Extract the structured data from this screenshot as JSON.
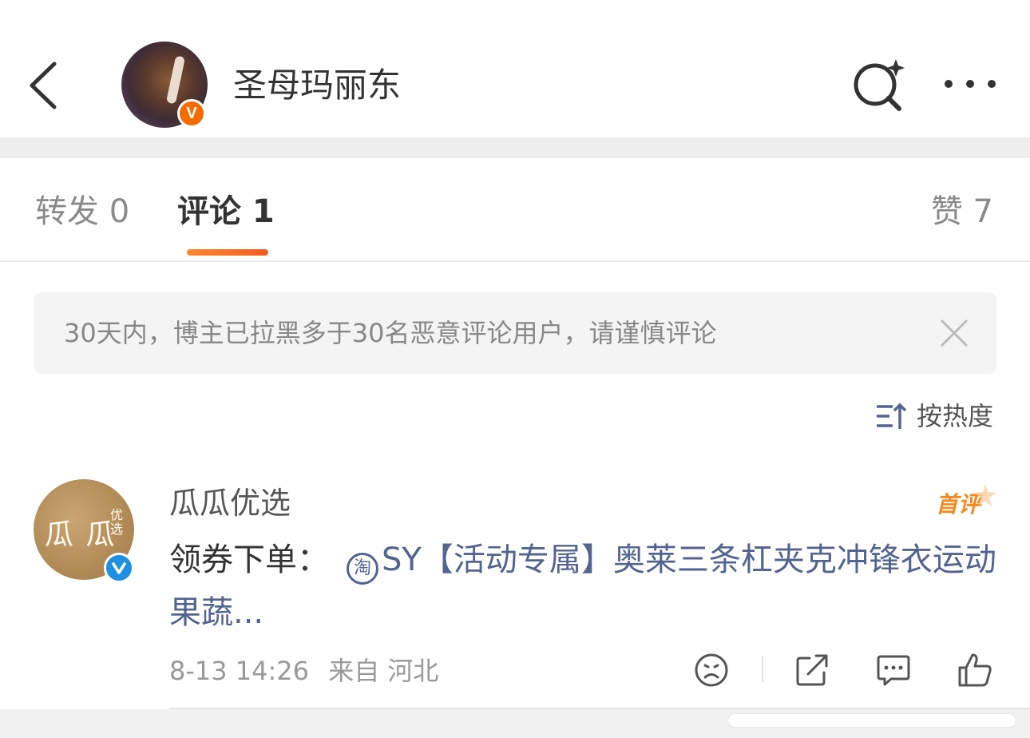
{
  "header": {
    "title": "圣母玛丽东",
    "badge_letter": "V"
  },
  "tabs": {
    "repost": "转发 0",
    "comment": "评论 1",
    "likes": "赞 7"
  },
  "notice": {
    "text": "30天内，博主已拉黑多于30名恶意评论用户，请谨慎评论"
  },
  "sort": {
    "label": "按热度"
  },
  "comment": {
    "author": "瓜瓜优选",
    "avatar_text": "瓜 瓜",
    "avatar_small": "优选",
    "first_badge": "首评",
    "prefix": "领券下单：",
    "taobao_icon": "淘",
    "link_text": "SY【活动专属】奥莱三条杠夹克冲锋衣运动果蔬...",
    "date": "8-13 14:26",
    "source": "来自 河北"
  },
  "colors": {
    "accent_orange": "#f45a1e",
    "link_blue": "#52648f",
    "badge_blue": "#1e8fe1"
  }
}
